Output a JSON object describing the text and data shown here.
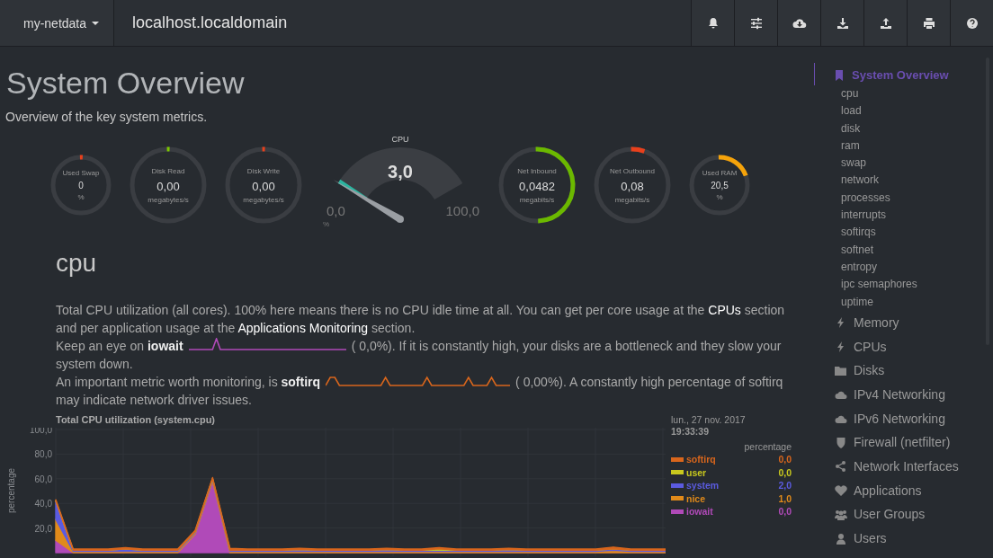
{
  "header": {
    "brand": "my-netdata",
    "host": "localhost.localdomain"
  },
  "page": {
    "title": "System Overview",
    "subtitle": "Overview of the key system metrics."
  },
  "gauges": [
    {
      "title": "Used Swap",
      "value": "0",
      "unit": "%",
      "level": 0,
      "color": "#e8401c"
    },
    {
      "title": "Disk Read",
      "value": "0,00",
      "unit": "megabytes/s",
      "level": 0,
      "color": "#7cc700"
    },
    {
      "title": "Disk Write",
      "value": "0,00",
      "unit": "megabytes/s",
      "level": 0,
      "color": "#e8401c"
    },
    {
      "title": "Net Inbound",
      "value": "0,0482",
      "unit": "megabits/s",
      "level": 0.5,
      "color": "#6bb800"
    },
    {
      "title": "Net Outbound",
      "value": "0,08",
      "unit": "megabits/s",
      "level": 0.06,
      "color": "#e8401c"
    },
    {
      "title": "Used RAM",
      "value": "20,5",
      "unit": "%",
      "level": 0.2,
      "color": "#f5a30a"
    }
  ],
  "cpu_gauge": {
    "title": "CPU",
    "value": "3,0",
    "min": "0,0",
    "max": "100,0",
    "unit": "%",
    "level": 0.03
  },
  "section": {
    "title": "cpu",
    "paragraphs": [
      [
        {
          "kind": "text",
          "text": "Total CPU utilization (all cores). 100% here means there is no CPU idle time at all. You can get per core usage at the "
        },
        {
          "kind": "link",
          "text": "CPUs"
        },
        {
          "kind": "text",
          "text": " section and per application usage at the "
        },
        {
          "kind": "link",
          "text": "Applications Monitoring"
        },
        {
          "kind": "text",
          "text": " section."
        }
      ],
      [
        {
          "kind": "text",
          "text": "Keep an eye on **iowait**"
        },
        {
          "kind": "sparkline",
          "color": "#b04ab8"
        },
        {
          "kind": "text",
          "text": "(       0,0%). If it is constantly high, your disks are a bottleneck and they slow your system down."
        }
      ],
      [
        {
          "kind": "text",
          "text": "An important metric worth monitoring, is **softirq**"
        },
        {
          "kind": "sparkline",
          "color": "#d9661c"
        },
        {
          "kind": "text",
          "text": "(       0,00%). A constantly high percentage of softirq may indicate network driver issues."
        }
      ]
    ]
  },
  "chart": {
    "date": "lun., 27 nov. 2017",
    "time": "19:33:39",
    "units": "percentage",
    "legend_values": [
      "0,0",
      "0,0",
      "2,0",
      "1,0",
      "0,0"
    ],
    "chart_data": {
      "type": "area",
      "title": "Total CPU utilization (system.cpu)",
      "ylabel": "percentage",
      "stacked": true,
      "grid": true,
      "ylim": [
        0,
        100
      ],
      "yticks": [
        {
          "value": 20,
          "label": "20,0"
        },
        {
          "value": 40,
          "label": "40,0"
        },
        {
          "value": 60,
          "label": "60,0"
        },
        {
          "value": 80,
          "label": "80,0"
        },
        {
          "value": 100,
          "label": "100,0"
        }
      ],
      "series": [
        {
          "name": "iowait",
          "color": "#b04ab8",
          "values": [
            10,
            0,
            0,
            0,
            0,
            0,
            0,
            0,
            15,
            58,
            0,
            0,
            0,
            0,
            0,
            0,
            0,
            0,
            0,
            0,
            0,
            0,
            0,
            0,
            0,
            0,
            0,
            0,
            0,
            0,
            0,
            0,
            0,
            0,
            0,
            0
          ]
        },
        {
          "name": "nice",
          "color": "#e08a1a",
          "values": [
            17,
            1,
            1,
            1,
            1,
            1,
            1,
            1,
            1,
            1,
            1,
            1,
            1,
            1,
            1,
            1,
            1,
            1,
            1,
            1,
            1,
            1,
            1,
            1,
            1,
            1,
            1,
            1,
            1,
            1,
            1,
            1,
            2,
            1,
            1,
            1
          ]
        },
        {
          "name": "system",
          "color": "#5b5be0",
          "values": [
            15,
            1,
            1,
            1,
            2,
            1,
            1,
            1,
            1,
            1,
            1,
            1,
            1,
            1,
            1.5,
            1,
            1,
            1,
            1,
            1.5,
            1,
            1,
            1,
            1,
            1,
            1,
            1.5,
            1,
            1,
            1,
            1,
            1,
            1,
            1,
            1,
            1
          ]
        },
        {
          "name": "user",
          "color": "#c8c81e",
          "values": [
            0,
            0,
            0,
            0,
            0,
            0,
            0,
            0,
            0,
            0,
            0,
            0,
            0,
            0,
            0,
            0,
            0,
            0,
            0,
            0,
            0,
            0,
            1,
            0,
            0,
            0,
            0,
            0,
            0,
            0,
            0,
            0,
            0,
            0,
            0,
            0
          ]
        },
        {
          "name": "softirq",
          "color": "#d9661c",
          "values": [
            1,
            1,
            1,
            1,
            1,
            1,
            1,
            1,
            1,
            1,
            1.5,
            1,
            1,
            1,
            1,
            1,
            1,
            1,
            1,
            1,
            1,
            1,
            1,
            1,
            1,
            1,
            1,
            1,
            1,
            1,
            1,
            1,
            1.5,
            1,
            1,
            1
          ]
        }
      ]
    }
  },
  "sidebar": {
    "title": "System Overview",
    "selected": true,
    "items": [
      "cpu",
      "load",
      "disk",
      "ram",
      "swap",
      "network",
      "processes",
      "interrupts",
      "softirqs",
      "softnet",
      "entropy",
      "ipc semaphores",
      "uptime"
    ],
    "sections": [
      "Memory",
      "CPUs",
      "Disks",
      "IPv4 Networking",
      "IPv6 Networking",
      "Firewall (netfilter)",
      "Network Interfaces",
      "Applications",
      "User Groups",
      "Users"
    ]
  }
}
